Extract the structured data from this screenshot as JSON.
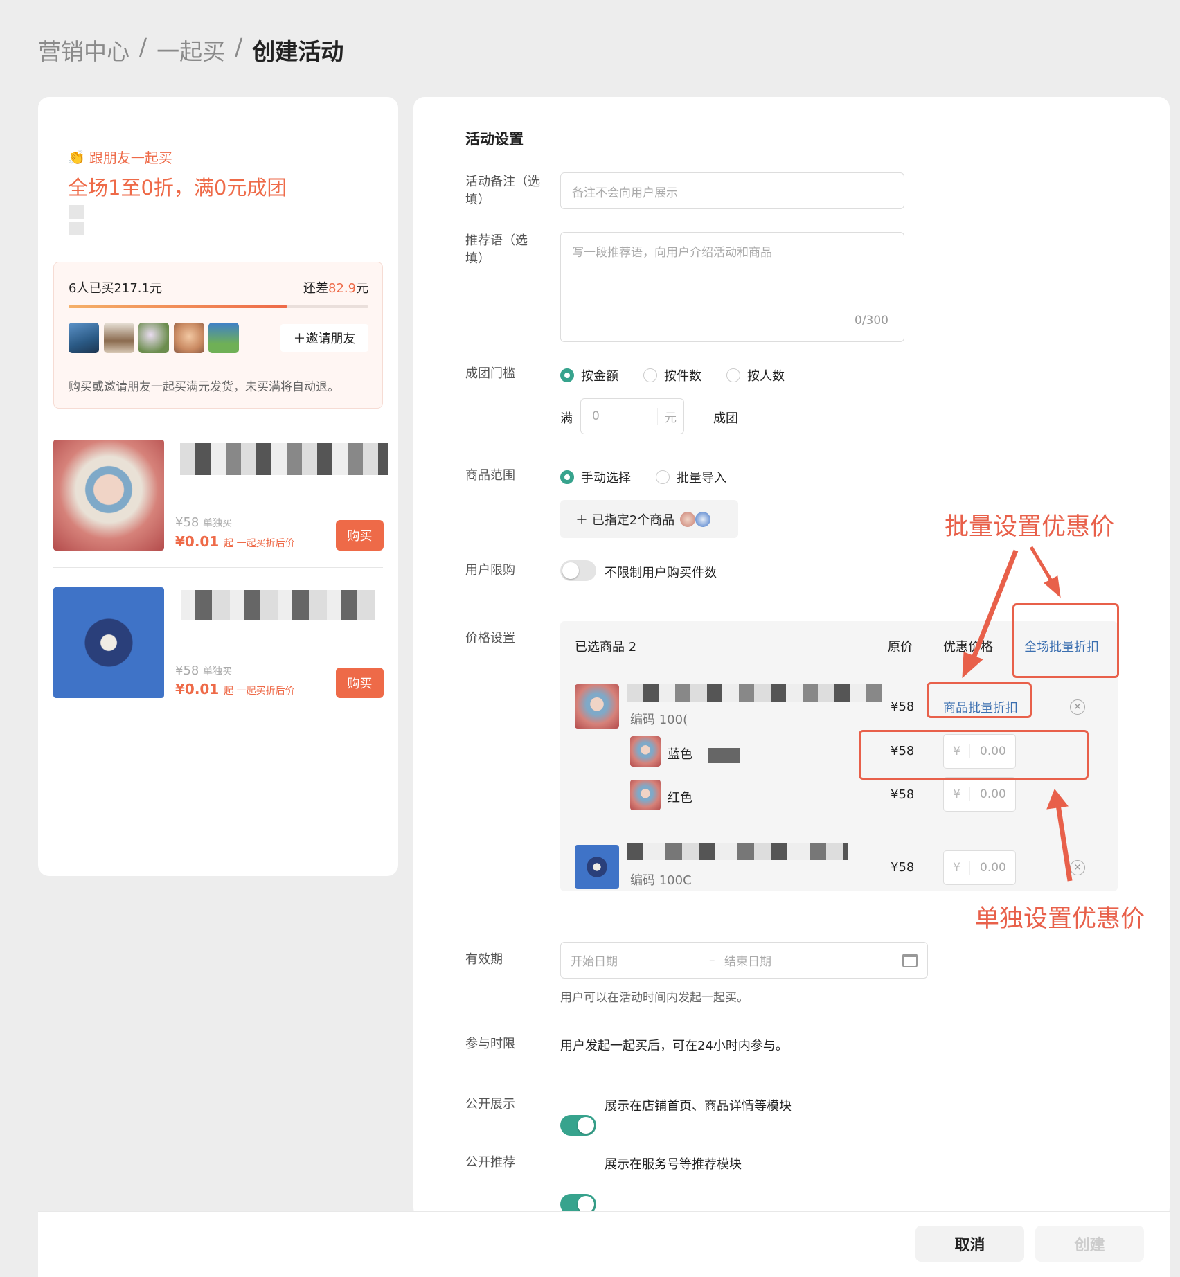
{
  "breadcrumb": {
    "items": [
      "营销中心",
      "一起买"
    ],
    "current": "创建活动"
  },
  "preview": {
    "brand": "跟朋友一起买",
    "promo": "全场1至0折，满0元成团",
    "group": {
      "stat": "6人已买217.1元",
      "need_prefix": "还差",
      "need_amount": "82.9",
      "need_suffix": "元",
      "progress": 0.73,
      "invite": "＋邀请朋友",
      "tip": "购买或邀请朋友一起买满元发货，未买满将自动退。"
    },
    "products": [
      {
        "single_price": "¥58",
        "single_label": "单独买",
        "group_price": "¥0.01",
        "group_label": "起 一起买折后价",
        "buy": "购买"
      },
      {
        "single_price": "¥58",
        "single_label": "单独买",
        "group_price": "¥0.01",
        "group_label": "起 一起买折后价",
        "buy": "购买"
      }
    ]
  },
  "form": {
    "section_title": "活动设置",
    "note": {
      "label": "活动备注（选填）",
      "placeholder": "备注不会向用户展示"
    },
    "recommend": {
      "label": "推荐语（选填）",
      "placeholder": "写一段推荐语，向用户介绍活动和商品",
      "counter": "0/300"
    },
    "threshold": {
      "label": "成团门槛",
      "options": [
        "按金额",
        "按件数",
        "按人数"
      ],
      "selected": "按金额",
      "prefix": "满",
      "value_placeholder": "0",
      "unit": "元",
      "suffix": "成团"
    },
    "scope": {
      "label": "商品范围",
      "options": [
        "手动选择",
        "批量导入"
      ],
      "selected": "手动选择",
      "selected_btn": "＋ 已指定2个商品"
    },
    "limit": {
      "label": "用户限购",
      "toggle": false,
      "text": "不限制用户购买件数"
    },
    "price": {
      "label": "价格设置",
      "header": {
        "selected": "已选商品 2",
        "orig": "原价",
        "discount": "优惠价格",
        "batch_all": "全场批量折扣"
      },
      "item1": {
        "code": "编码 100(",
        "price": "¥58",
        "batch": "商品批量折扣",
        "variants": [
          {
            "name": "蓝色",
            "price": "¥58",
            "currency": "¥",
            "placeholder": "0.00"
          },
          {
            "name": "红色",
            "price": "¥58",
            "currency": "¥",
            "placeholder": "0.00"
          }
        ]
      },
      "item2": {
        "code": "编码 100C",
        "price": "¥58",
        "currency": "¥",
        "placeholder": "0.00"
      }
    },
    "validity": {
      "label": "有效期",
      "start": "开始日期",
      "sep": "–",
      "end": "结束日期",
      "hint": "用户可以在活动时间内发起一起买。"
    },
    "join": {
      "label": "参与时限",
      "text": "用户发起一起买后，可在24小时内参与。"
    },
    "public_show": {
      "label": "公开展示",
      "toggle": true,
      "text": "展示在店铺首页、商品详情等模块"
    },
    "public_rec": {
      "label": "公开推荐",
      "toggle": true,
      "text": "展示在服务号等推荐模块"
    }
  },
  "annotations": {
    "batch": "批量设置优惠价",
    "single": "单独设置优惠价"
  },
  "footer": {
    "cancel": "取消",
    "create": "创建"
  },
  "colors": {
    "accent": "#ee6a48",
    "primary": "#37a38d",
    "highlight": "#e8604a",
    "link": "#3b6fb0"
  }
}
